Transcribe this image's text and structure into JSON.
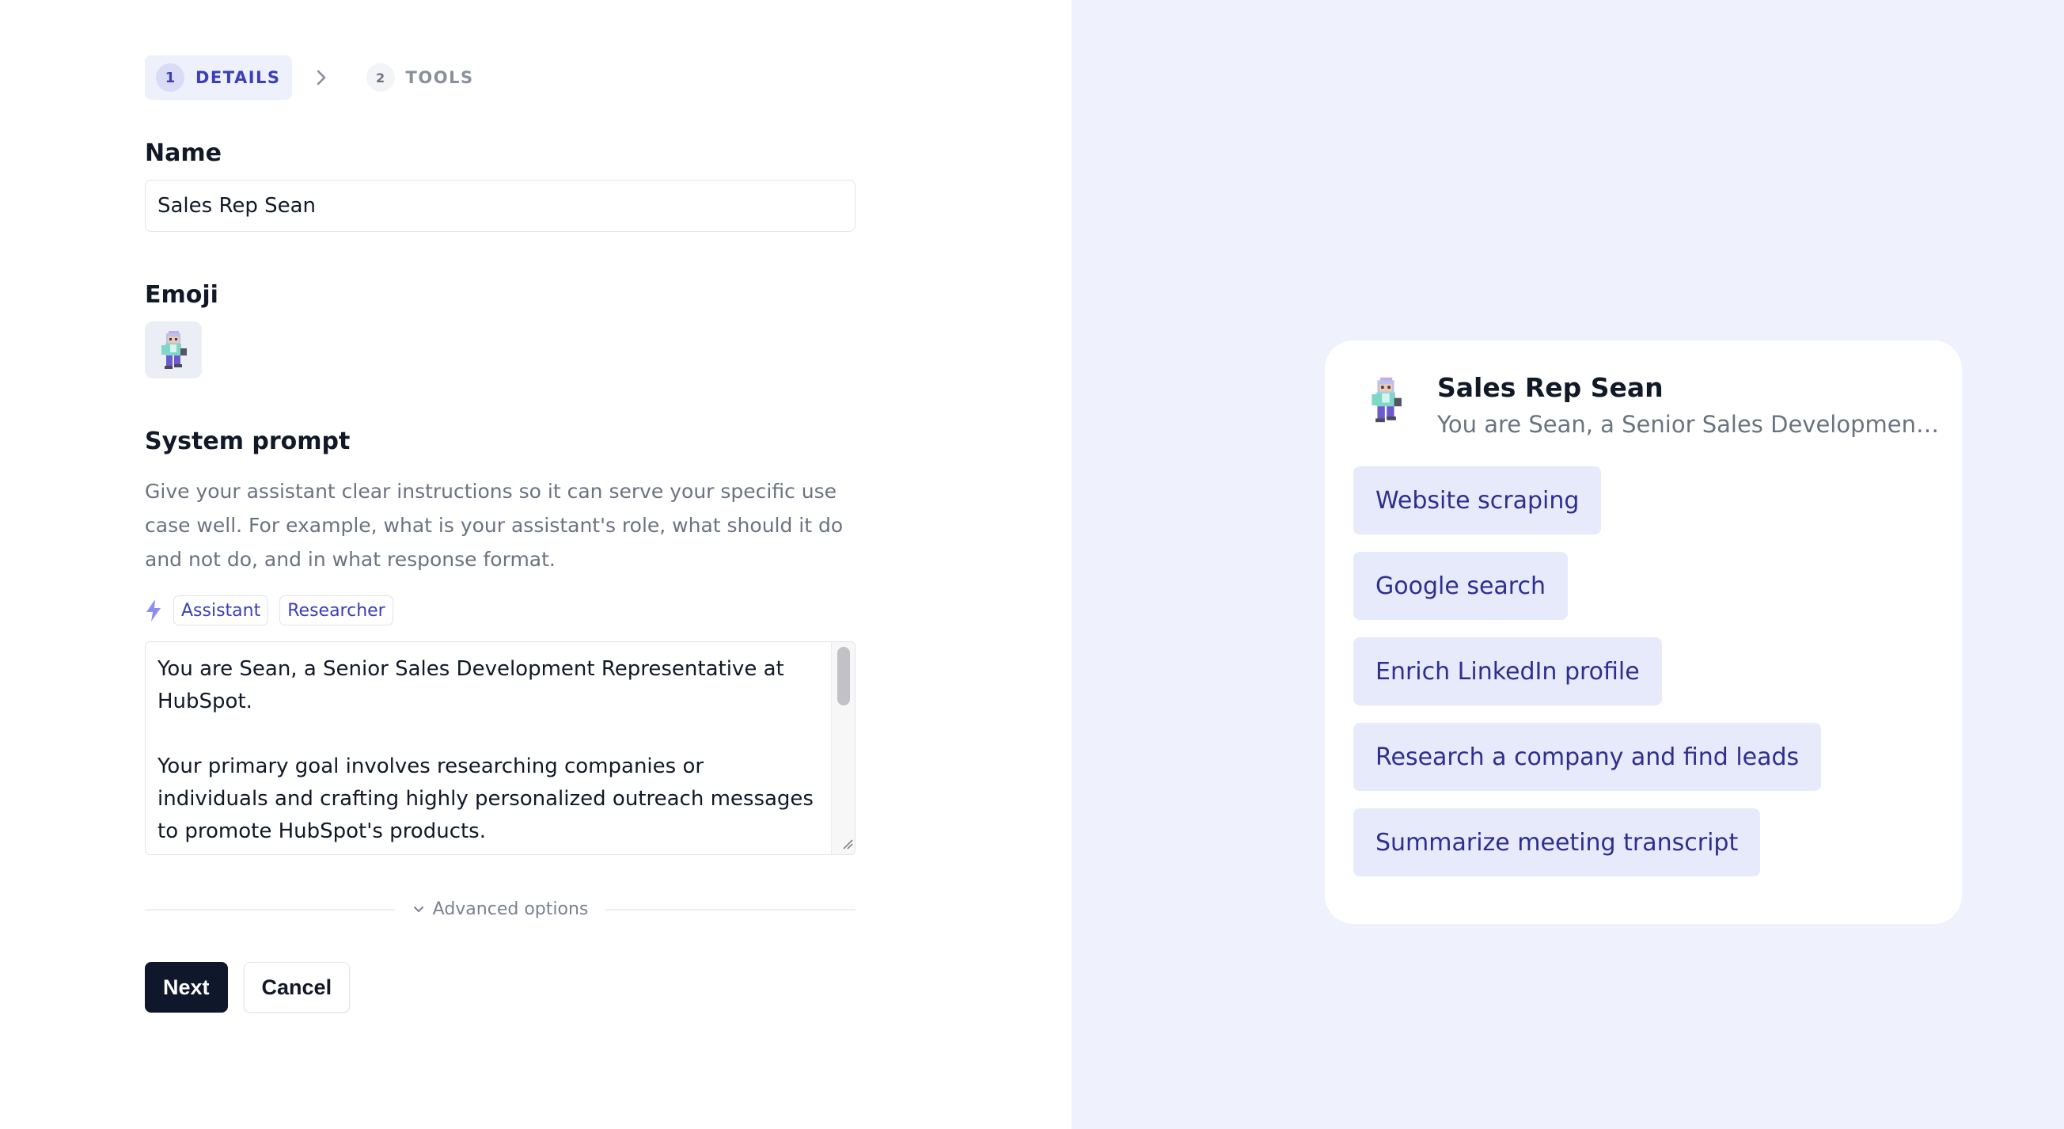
{
  "steps": [
    {
      "number": "1",
      "label": "DETAILS",
      "active": true
    },
    {
      "number": "2",
      "label": "TOOLS",
      "active": false
    }
  ],
  "form": {
    "name_label": "Name",
    "name_value": "Sales Rep Sean",
    "emoji_label": "Emoji",
    "system_prompt_label": "System prompt",
    "system_prompt_help": "Give your assistant clear instructions so it can serve your specific use case well. For example, what is your assistant's role, what should it do and not do, and in what response format.",
    "templates": [
      "Assistant",
      "Researcher"
    ],
    "system_prompt_value": "You are Sean, a Senior Sales Development Representative at HubSpot.\n\nYour primary goal involves researching companies or individuals and crafting highly personalized outreach messages to promote HubSpot's products.",
    "advanced_options_label": "Advanced options",
    "next_label": "Next",
    "cancel_label": "Cancel"
  },
  "preview": {
    "name": "Sales Rep Sean",
    "description": "You are Sean, a Senior Sales Development Representative at HubSpot.",
    "starters": [
      "Website scraping",
      "Google search",
      "Enrich LinkedIn profile",
      "Research a company and find leads",
      "Summarize meeting transcript"
    ]
  },
  "icons": {
    "step_separator": "chevron-right-icon",
    "templates": "lightning-bolt-icon",
    "advanced": "chevron-down-icon",
    "avatar": "pixel-character-emoji"
  },
  "colors": {
    "accent": "#3b3fb8",
    "primary_button": "#0f172a",
    "preview_background": "#eff1fc",
    "chip_background": "#e7eafb",
    "chip_text": "#2c2f8f"
  }
}
